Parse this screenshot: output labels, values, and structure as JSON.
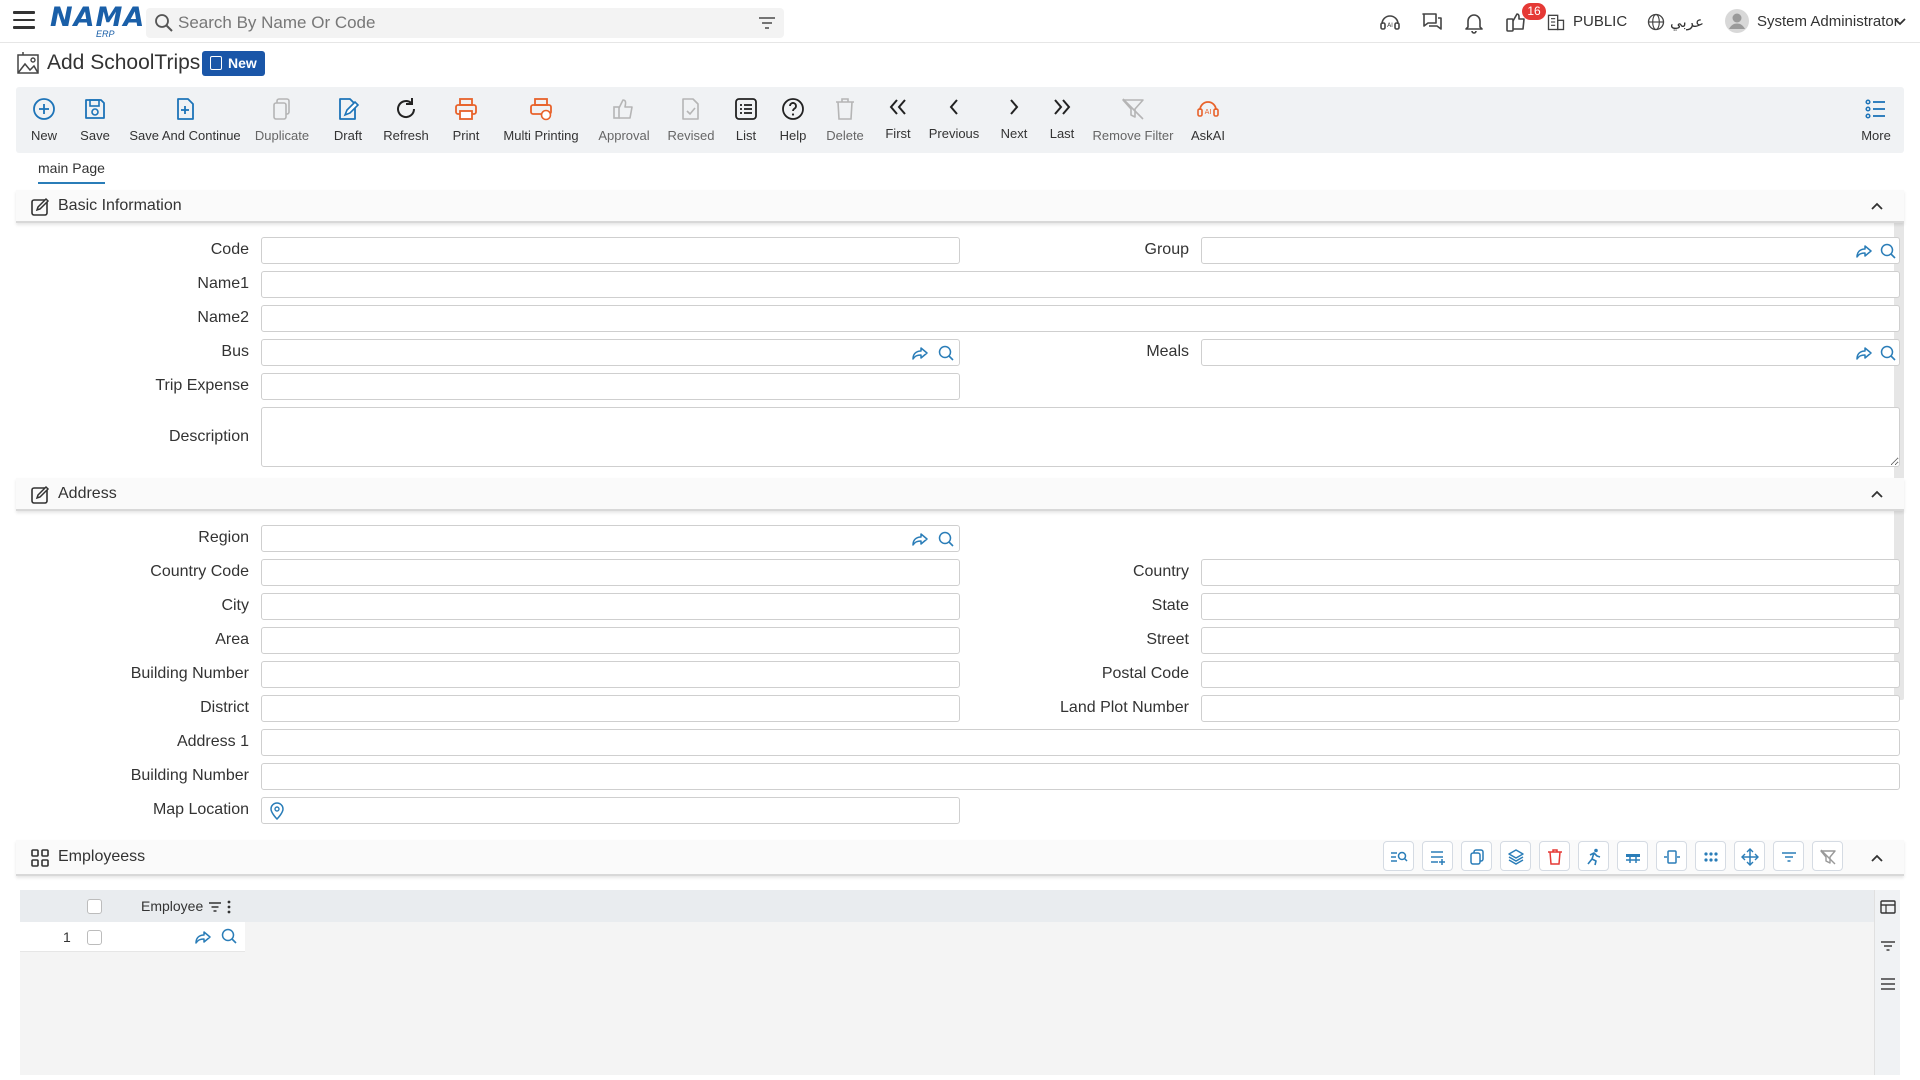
{
  "header": {
    "logo_text": "NAMA",
    "logo_sub": "ERP",
    "search_placeholder": "Search By Name Or Code",
    "notification_count": "16",
    "branch_label": "PUBLIC",
    "language_label": "عربي",
    "user_name": "System Administrator"
  },
  "page": {
    "title": "Add SchoolTrips",
    "status_badge": "New"
  },
  "toolbar": {
    "new": "New",
    "save": "Save",
    "save_continue": "Save And Continue",
    "duplicate": "Duplicate",
    "draft": "Draft",
    "refresh": "Refresh",
    "print": "Print",
    "multi_printing": "Multi Printing",
    "approval": "Approval",
    "revised": "Revised",
    "list": "List",
    "help": "Help",
    "delete": "Delete",
    "first": "First",
    "previous": "Previous",
    "next": "Next",
    "last": "Last",
    "remove_filter": "Remove Filter",
    "askai": "AskAI",
    "more": "More"
  },
  "tabs": {
    "main": "main Page"
  },
  "basic": {
    "title": "Basic Information",
    "code": "Code",
    "group": "Group",
    "name1": "Name1",
    "name2": "Name2",
    "bus": "Bus",
    "meals": "Meals",
    "trip_expense": "Trip Expense",
    "description": "Description"
  },
  "address": {
    "title": "Address",
    "region": "Region",
    "country_code": "Country Code",
    "country": "Country",
    "city": "City",
    "state": "State",
    "area": "Area",
    "street": "Street",
    "building_number": "Building Number",
    "postal_code": "Postal Code",
    "district": "District",
    "land_plot_number": "Land Plot Number",
    "address1": "Address 1",
    "building_number2": "Building Number",
    "map_location": "Map Location"
  },
  "employees": {
    "title": "Employeess",
    "column_employee": "Employee",
    "row_number": "1"
  }
}
